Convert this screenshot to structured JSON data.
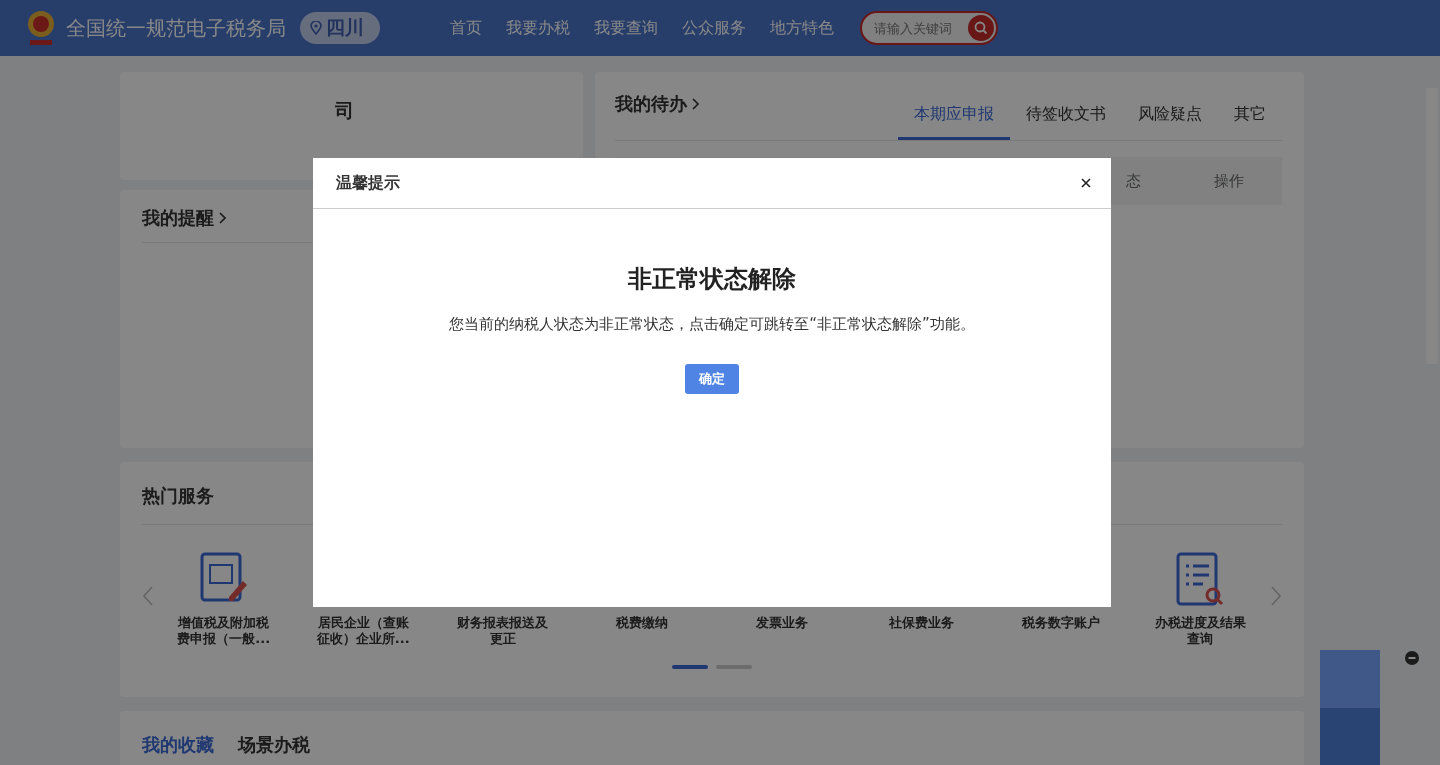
{
  "header": {
    "title": "全国统一规范电子税务局",
    "region": "四川",
    "nav": [
      {
        "label": "首页"
      },
      {
        "label": "我要办税"
      },
      {
        "label": "我要查询"
      },
      {
        "label": "公众服务"
      },
      {
        "label": "地方特色"
      }
    ],
    "search": {
      "placeholder": "请输入关键词"
    }
  },
  "company_card": {
    "name": "司"
  },
  "reminders": {
    "title": "我的提醒"
  },
  "todo": {
    "title": "我的待办",
    "tabs": [
      {
        "label": "本期应申报",
        "selected": true
      },
      {
        "label": "待签收文书",
        "selected": false
      },
      {
        "label": "风险疑点",
        "selected": false
      },
      {
        "label": "其它",
        "selected": false
      }
    ],
    "columns": [
      "态",
      "操作"
    ]
  },
  "hot_services": {
    "title": "热门服务",
    "items": [
      {
        "label": "增值税及附加税费申报（一般...",
        "kind": "form"
      },
      {
        "label": "居民企业（查账征收）企业所..."
      },
      {
        "label": "财务报表报送及更正"
      },
      {
        "label": "税费缴纳"
      },
      {
        "label": "发票业务"
      },
      {
        "label": "社保费业务"
      },
      {
        "label": "税务数字账户"
      },
      {
        "label": "办税进度及结果查询",
        "kind": "search-list"
      }
    ],
    "pager": [
      {
        "selected": true
      },
      {
        "selected": false
      }
    ]
  },
  "favorites": {
    "tabs": [
      {
        "label": "我的收藏",
        "selected": true
      },
      {
        "label": "场景办税",
        "selected": false
      }
    ]
  },
  "modal": {
    "title": "温馨提示",
    "heading": "非正常状态解除",
    "message": "您当前的纳税人状态为非正常状态，点击确定可跳转至“非正常状态解除”功能。",
    "button": "确定"
  }
}
